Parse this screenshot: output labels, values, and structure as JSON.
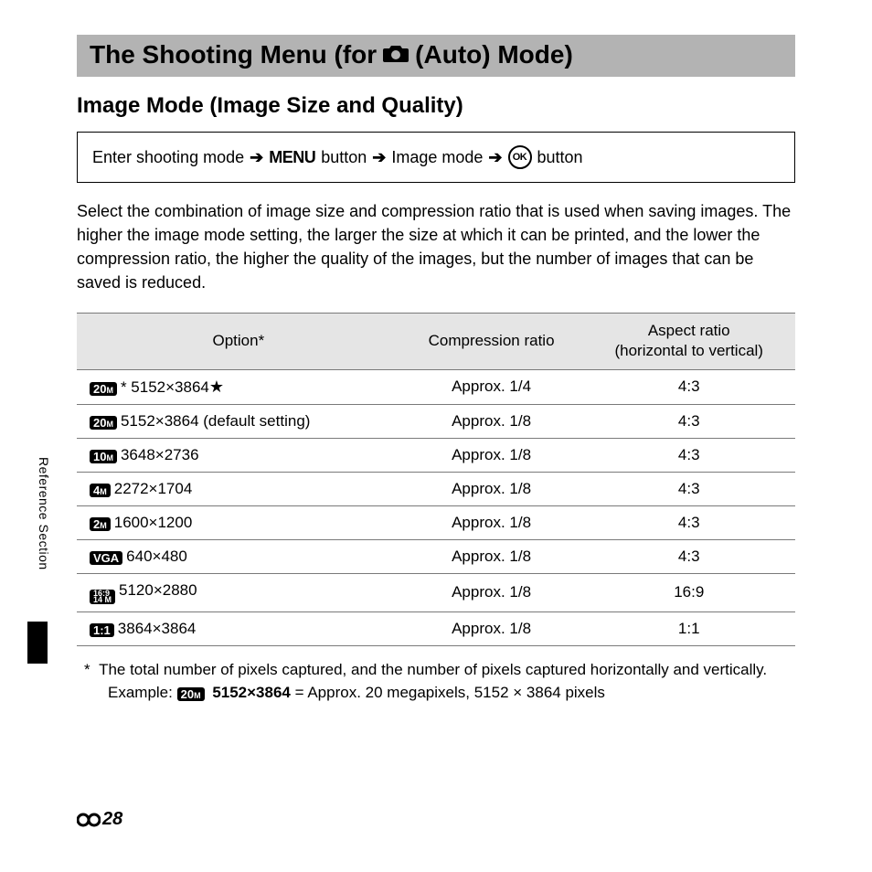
{
  "title": {
    "prefix": "The Shooting Menu (for",
    "suffix": "(Auto) Mode)"
  },
  "section_heading": "Image Mode (Image Size and Quality)",
  "nav": {
    "step1": "Enter shooting mode",
    "menu_label": "MENU",
    "step2_suffix": "button",
    "step3": "Image mode",
    "ok_label": "OK",
    "step4_suffix": "button"
  },
  "intro": "Select the combination of image size and compression ratio that is used when saving images. The higher the image mode setting, the larger the size at which it can be printed, and the lower the compression ratio, the higher the quality of the images, but the number of images that can be saved is reduced.",
  "table": {
    "headers": {
      "option": "Option*",
      "compression": "Compression ratio",
      "aspect": "Aspect ratio\n(horizontal to vertical)"
    },
    "rows": [
      {
        "badge_main": "20",
        "badge_sub": "M",
        "badge_star_prefix": "*",
        "size": "5152×3864",
        "trailing_star": true,
        "default": false,
        "compression": "Approx. 1/4",
        "aspect": "4:3"
      },
      {
        "badge_main": "20",
        "badge_sub": "M",
        "size": "5152×3864",
        "default": true,
        "compression": "Approx. 1/8",
        "aspect": "4:3"
      },
      {
        "badge_main": "10",
        "badge_sub": "M",
        "size": "3648×2736",
        "compression": "Approx. 1/8",
        "aspect": "4:3"
      },
      {
        "badge_main": "4",
        "badge_sub": "M",
        "size": "2272×1704",
        "compression": "Approx. 1/8",
        "aspect": "4:3"
      },
      {
        "badge_main": "2",
        "badge_sub": "M",
        "size": "1600×1200",
        "compression": "Approx. 1/8",
        "aspect": "4:3"
      },
      {
        "badge_main": "VGA",
        "badge_sub": "",
        "size": "640×480",
        "compression": "Approx. 1/8",
        "aspect": "4:3"
      },
      {
        "badge_main": "16:9",
        "badge_sub": "14 M",
        "stacked": true,
        "size": "5120×2880",
        "compression": "Approx. 1/8",
        "aspect": "16:9"
      },
      {
        "badge_main": "1:1",
        "badge_sub": "",
        "size": "3864×3864",
        "compression": "Approx. 1/8",
        "aspect": "1:1"
      }
    ],
    "default_label": "(default setting)"
  },
  "footnote": {
    "text": "The total number of pixels captured, and the number of pixels captured horizontally and vertically.",
    "example_prefix": "Example:",
    "example_badge_main": "20",
    "example_badge_sub": "M",
    "example_bold": "5152×3864",
    "example_rest": "= Approx. 20 megapixels, 5152 × 3864 pixels"
  },
  "side_label": "Reference Section",
  "page_number": "28"
}
